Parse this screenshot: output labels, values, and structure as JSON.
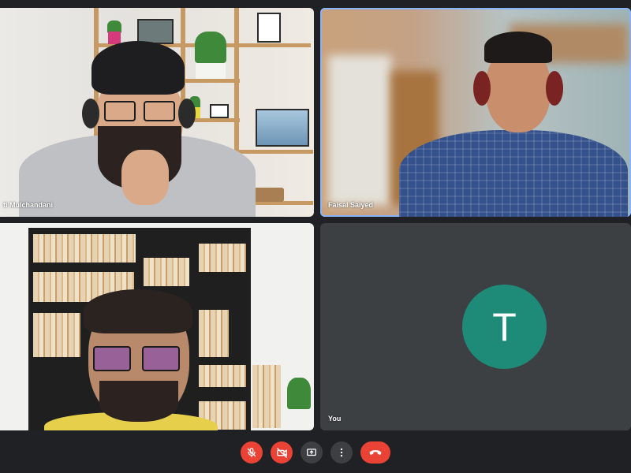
{
  "participants": [
    {
      "name": "ti Mulchandani",
      "active": false
    },
    {
      "name": "Faisal Saiyed",
      "active": true
    },
    {
      "name": "",
      "active": false
    },
    {
      "name": "You",
      "avatar_letter": "T",
      "avatar_color": "#1e8a78",
      "active": false
    }
  ],
  "controls": {
    "mic": {
      "icon": "mic-off-icon",
      "state": "muted",
      "color": "#ea4335"
    },
    "camera": {
      "icon": "camera-off-icon",
      "state": "off",
      "color": "#ea4335"
    },
    "present": {
      "icon": "present-screen-icon"
    },
    "more": {
      "icon": "more-vert-icon"
    },
    "end_call": {
      "icon": "end-call-icon",
      "color": "#ea4335"
    }
  },
  "colors": {
    "background": "#202124",
    "tile": "#3c4043",
    "active_border": "#8ab4f8"
  }
}
